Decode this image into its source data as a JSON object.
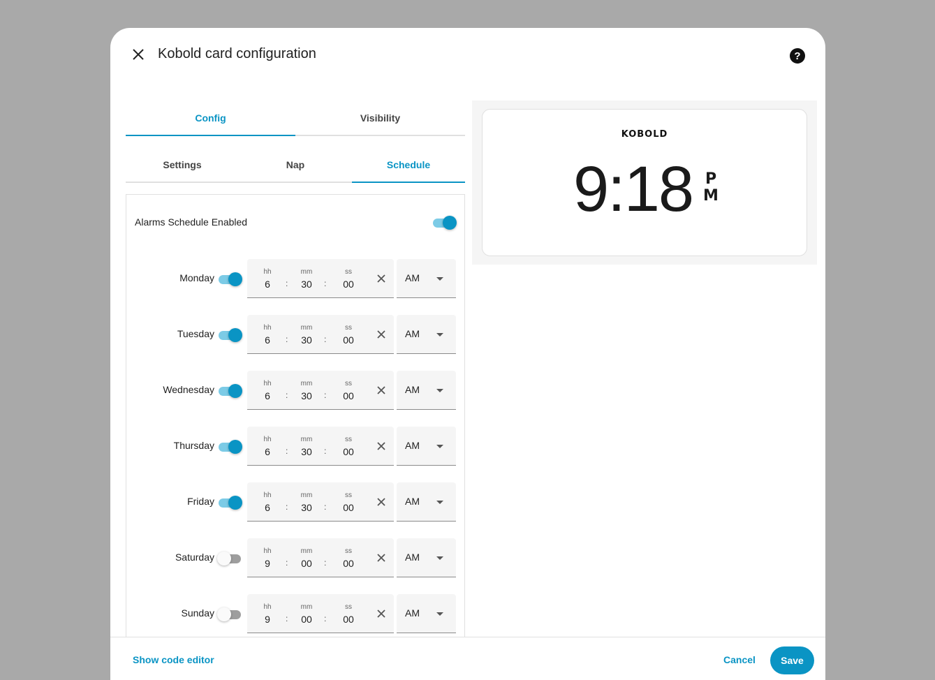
{
  "dialog": {
    "title": "Kobold card configuration"
  },
  "tabs": [
    {
      "label": "Config",
      "active": true
    },
    {
      "label": "Visibility",
      "active": false
    }
  ],
  "subtabs": [
    {
      "label": "Settings",
      "active": false
    },
    {
      "label": "Nap",
      "active": false
    },
    {
      "label": "Schedule",
      "active": true
    }
  ],
  "schedule": {
    "enabled_label": "Alarms Schedule Enabled",
    "enabled": true,
    "field_labels": {
      "hh": "hh",
      "mm": "mm",
      "ss": "ss"
    },
    "days": [
      {
        "name": "Monday",
        "enabled": true,
        "hh": "6",
        "mm": "30",
        "ss": "00",
        "period": "AM"
      },
      {
        "name": "Tuesday",
        "enabled": true,
        "hh": "6",
        "mm": "30",
        "ss": "00",
        "period": "AM"
      },
      {
        "name": "Wednesday",
        "enabled": true,
        "hh": "6",
        "mm": "30",
        "ss": "00",
        "period": "AM"
      },
      {
        "name": "Thursday",
        "enabled": true,
        "hh": "6",
        "mm": "30",
        "ss": "00",
        "period": "AM"
      },
      {
        "name": "Friday",
        "enabled": true,
        "hh": "6",
        "mm": "30",
        "ss": "00",
        "period": "AM"
      },
      {
        "name": "Saturday",
        "enabled": false,
        "hh": "9",
        "mm": "00",
        "ss": "00",
        "period": "AM"
      },
      {
        "name": "Sunday",
        "enabled": false,
        "hh": "9",
        "mm": "00",
        "ss": "00",
        "period": "AM"
      }
    ]
  },
  "preview": {
    "brand": "KOBOLD",
    "time": "9:18",
    "meridiem_top": "P",
    "meridiem_bottom": "M"
  },
  "footer": {
    "code_editor_label": "Show code editor",
    "cancel_label": "Cancel",
    "save_label": "Save"
  },
  "colors": {
    "accent": "#0a94c4",
    "overlay": "#a9a9a9"
  },
  "icons": {
    "close": "close-icon",
    "help": "help-circle-icon",
    "clear": "clear-icon",
    "dropdown": "caret-down-icon"
  }
}
